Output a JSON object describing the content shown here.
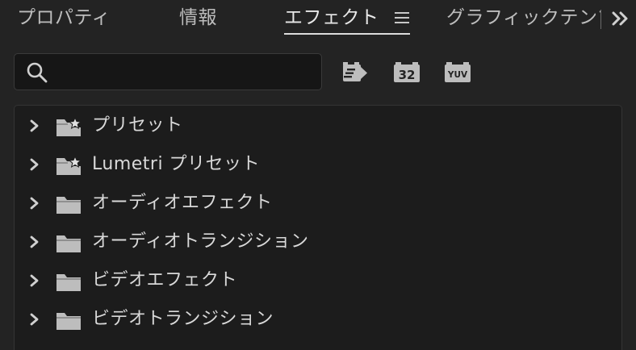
{
  "tabs": [
    {
      "label": "プロパティ",
      "active": false
    },
    {
      "label": "情報",
      "active": false
    },
    {
      "label": "エフェクト",
      "active": true
    },
    {
      "label": "グラフィックテンプレート",
      "active": false
    }
  ],
  "search": {
    "value": "",
    "placeholder": ""
  },
  "filters": {
    "accelerated": {
      "icon": "accelerated-effects-icon"
    },
    "bit32": {
      "icon": "32-bit-icon",
      "label": "32"
    },
    "yuv": {
      "icon": "yuv-icon",
      "label": "YUV"
    }
  },
  "tree": [
    {
      "label": "プリセット",
      "icon": "preset-folder-icon",
      "starred": true
    },
    {
      "label": "Lumetri プリセット",
      "icon": "preset-folder-icon",
      "starred": true
    },
    {
      "label": "オーディオエフェクト",
      "icon": "folder-icon",
      "starred": false
    },
    {
      "label": "オーディオトランジション",
      "icon": "folder-icon",
      "starred": false
    },
    {
      "label": "ビデオエフェクト",
      "icon": "folder-icon",
      "starred": false
    },
    {
      "label": "ビデオトランジション",
      "icon": "folder-icon",
      "starred": false
    }
  ],
  "colors": {
    "background": "#232323",
    "panel": "#1c1c1c",
    "text": "#d9d9d9",
    "icon": "#bdbdbd"
  }
}
